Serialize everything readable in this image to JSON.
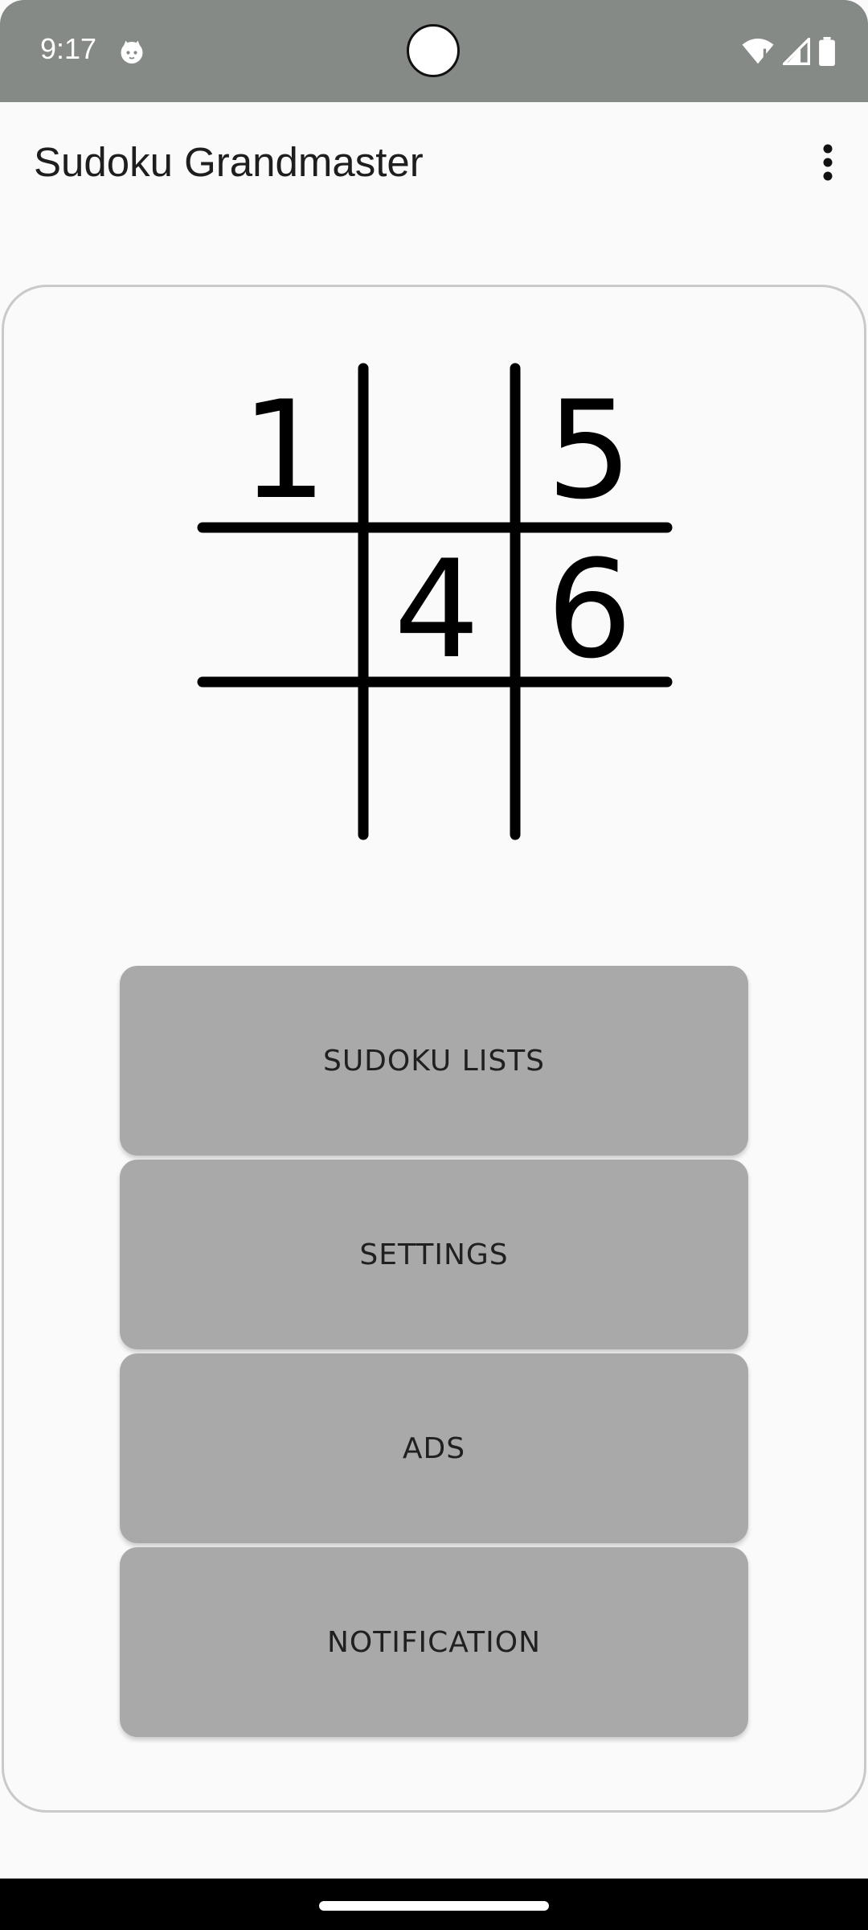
{
  "status_bar": {
    "time": "9:17",
    "background": "#858a86",
    "icons": [
      "cat-notification-icon",
      "wifi-icon",
      "cell-signal-icon",
      "battery-icon"
    ]
  },
  "app_bar": {
    "title": "Sudoku Grandmaster",
    "menu_icon": "more-vert-icon"
  },
  "logo": {
    "digits": [
      "1",
      "5",
      "4",
      "6"
    ]
  },
  "menu": {
    "sudoku_lists": "SUDOKU LISTS",
    "settings": "SETTINGS",
    "ads": "ADS",
    "notification": "NOTIFICATION"
  },
  "colors": {
    "button_bg": "#a9a9a9",
    "card_border": "#c9c9c9",
    "page_bg": "#fafafa"
  }
}
